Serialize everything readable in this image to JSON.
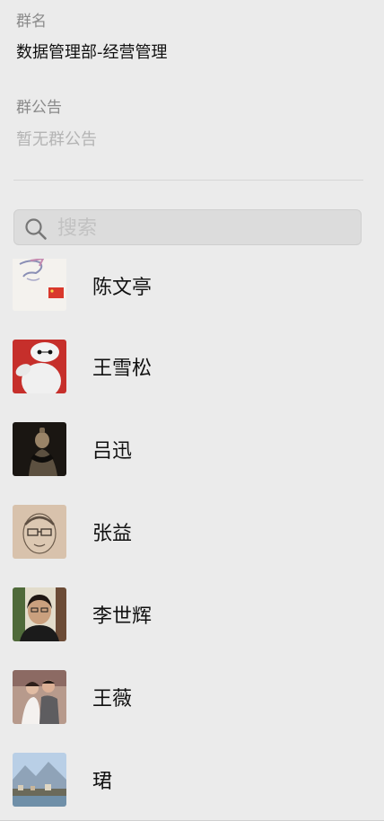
{
  "group_info": {
    "name_label": "群名",
    "name_value": "数据管理部-经营管理",
    "announcement_label": "群公告",
    "announcement_value": "暂无群公告"
  },
  "search": {
    "icon": "search-icon",
    "placeholder": "搜索"
  },
  "members": [
    {
      "name": "陈文亭",
      "avatar": "avatar-sketch-flag"
    },
    {
      "name": "王雪松",
      "avatar": "avatar-white-robot-red"
    },
    {
      "name": "吕迅",
      "avatar": "avatar-terracotta-figure"
    },
    {
      "name": "张益",
      "avatar": "avatar-pencil-sketch-face"
    },
    {
      "name": "李世辉",
      "avatar": "avatar-portrait-glasses"
    },
    {
      "name": "王薇",
      "avatar": "avatar-wedding-couple"
    },
    {
      "name": "珺",
      "avatar": "avatar-lake-town"
    }
  ],
  "colors": {
    "background": "#ebebeb",
    "label_gray": "#8a8a8a",
    "placeholder_gray": "#b4b4b4"
  }
}
